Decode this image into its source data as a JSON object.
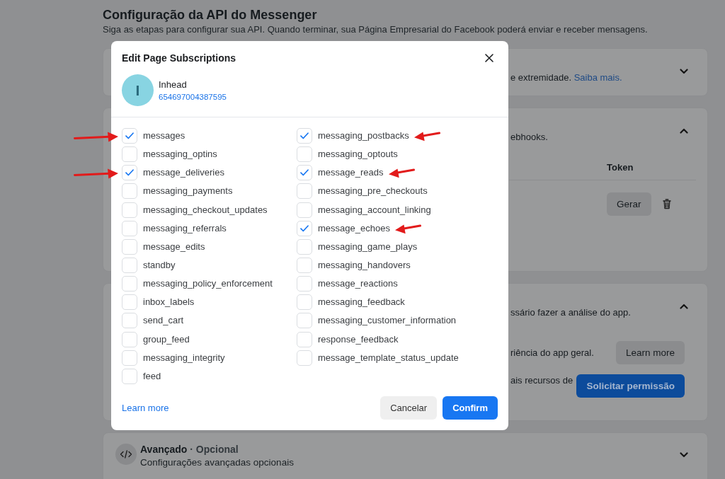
{
  "page": {
    "title": "Configuração da API do Messenger",
    "subtitle": "Siga as etapas para configurar sua API. Quando terminar, sua Página Empresarial do Facebook poderá enviar e receber mensagens.",
    "cards": [
      {
        "kind": "note",
        "expanded": false,
        "text": "e extremidade.",
        "link": "Saiba mais."
      },
      {
        "kind": "webhooks",
        "expanded": true,
        "text": "ebhooks.",
        "column": "Token",
        "button": "Gerar"
      },
      {
        "kind": "permissions",
        "expanded": true,
        "text": "ssário fazer a análise do app.",
        "rows": [
          {
            "text": "riência do app geral.",
            "button": "Learn more",
            "kind": "secondary"
          },
          {
            "text": "ais recursos de",
            "button": "Solicitar permissão",
            "kind": "primary"
          }
        ]
      },
      {
        "kind": "section",
        "expanded": false,
        "title": "Avançado",
        "tag": "· Opcional",
        "text": "Configurações avançadas opcionais"
      }
    ]
  },
  "dialog": {
    "title": "Edit Page Subscriptions",
    "account": {
      "initial": "I",
      "name": "Inhead",
      "id": "654697004387595"
    },
    "columns": [
      {
        "items": [
          {
            "label": "messages",
            "checked": true,
            "arrow": true
          },
          {
            "label": "messaging_optins",
            "checked": false,
            "arrow": false
          },
          {
            "label": "message_deliveries",
            "checked": true,
            "arrow": true
          },
          {
            "label": "messaging_payments",
            "checked": false,
            "arrow": false
          },
          {
            "label": "messaging_checkout_updates",
            "checked": false,
            "arrow": false
          },
          {
            "label": "messaging_referrals",
            "checked": false,
            "arrow": false
          },
          {
            "label": "message_edits",
            "checked": false,
            "arrow": false
          },
          {
            "label": "standby",
            "checked": false,
            "arrow": false
          },
          {
            "label": "messaging_policy_enforcement",
            "checked": false,
            "arrow": false
          },
          {
            "label": "inbox_labels",
            "checked": false,
            "arrow": false
          },
          {
            "label": "send_cart",
            "checked": false,
            "arrow": false
          },
          {
            "label": "group_feed",
            "checked": false,
            "arrow": false
          },
          {
            "label": "messaging_integrity",
            "checked": false,
            "arrow": false
          },
          {
            "label": "feed",
            "checked": false,
            "arrow": false
          }
        ]
      },
      {
        "items": [
          {
            "label": "messaging_postbacks",
            "checked": true,
            "arrow": true
          },
          {
            "label": "messaging_optouts",
            "checked": false,
            "arrow": false
          },
          {
            "label": "message_reads",
            "checked": true,
            "arrow": true
          },
          {
            "label": "messaging_pre_checkouts",
            "checked": false,
            "arrow": false
          },
          {
            "label": "messaging_account_linking",
            "checked": false,
            "arrow": false
          },
          {
            "label": "message_echoes",
            "checked": true,
            "arrow": true
          },
          {
            "label": "messaging_game_plays",
            "checked": false,
            "arrow": false
          },
          {
            "label": "messaging_handovers",
            "checked": false,
            "arrow": false
          },
          {
            "label": "message_reactions",
            "checked": false,
            "arrow": false
          },
          {
            "label": "messaging_feedback",
            "checked": false,
            "arrow": false
          },
          {
            "label": "messaging_customer_information",
            "checked": false,
            "arrow": false
          },
          {
            "label": "response_feedback",
            "checked": false,
            "arrow": false
          },
          {
            "label": "message_template_status_update",
            "checked": false,
            "arrow": false
          }
        ]
      }
    ],
    "link": "Learn more",
    "buttons": [
      {
        "label": "Cancelar",
        "kind": "secondary"
      },
      {
        "label": "Confirm",
        "kind": "primary"
      }
    ]
  }
}
